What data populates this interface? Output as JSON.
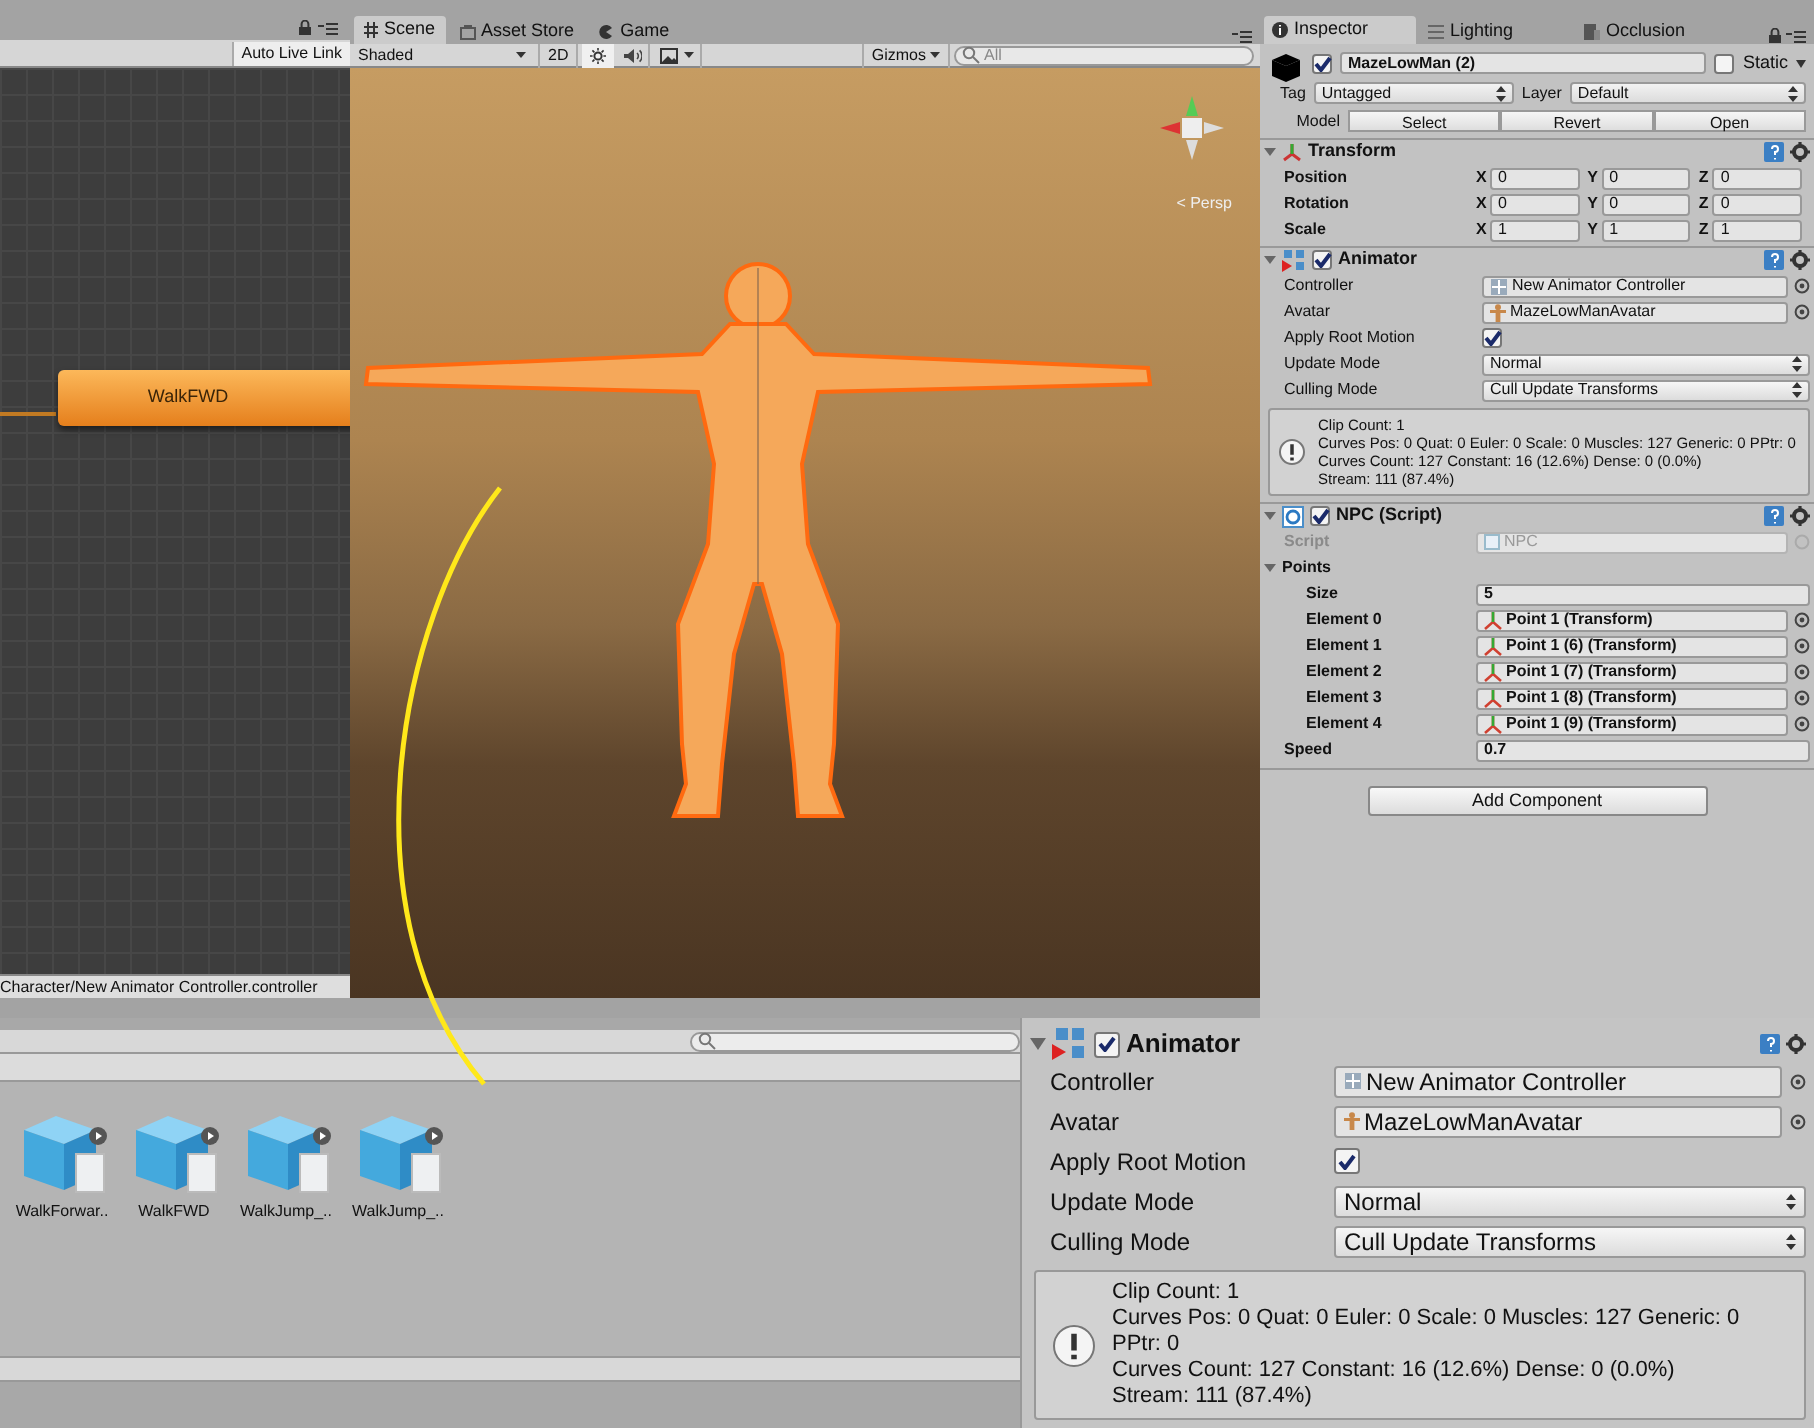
{
  "animator_window": {
    "auto_live_link": "Auto Live Link",
    "state": "WalkFWD",
    "path": "Character/New Animator Controller.controller"
  },
  "scene_window": {
    "tabs": [
      {
        "label": "Scene",
        "selected": true
      },
      {
        "label": "Asset Store",
        "selected": false
      },
      {
        "label": "Game",
        "selected": false
      }
    ],
    "shading": "Shaded",
    "mode_2d": "2D",
    "gizmos": "Gizmos",
    "search_placeholder": "All",
    "projection": "< Persp"
  },
  "inspector": {
    "tabs": [
      {
        "label": "Inspector",
        "selected": true
      },
      {
        "label": "Lighting",
        "selected": false
      },
      {
        "label": "Occlusion",
        "selected": false
      }
    ],
    "object": {
      "active": true,
      "name": "MazeLowMan (2)",
      "static": false,
      "static_label": "Static",
      "tag_label": "Tag",
      "tag": "Untagged",
      "layer_label": "Layer",
      "layer": "Default",
      "model_label": "Model",
      "model_buttons": [
        "Select",
        "Revert",
        "Open"
      ]
    },
    "components": [
      {
        "kind": "transform",
        "title": "Transform",
        "expanded": true,
        "rows": [
          {
            "label": "Position",
            "fields": [
              {
                "axis": "X",
                "value": "0"
              },
              {
                "axis": "Y",
                "value": "0"
              },
              {
                "axis": "Z",
                "value": "0"
              }
            ]
          },
          {
            "label": "Rotation",
            "fields": [
              {
                "axis": "X",
                "value": "0"
              },
              {
                "axis": "Y",
                "value": "0"
              },
              {
                "axis": "Z",
                "value": "0"
              }
            ]
          },
          {
            "label": "Scale",
            "fields": [
              {
                "axis": "X",
                "value": "1"
              },
              {
                "axis": "Y",
                "value": "1"
              },
              {
                "axis": "Z",
                "value": "1"
              }
            ]
          }
        ]
      },
      {
        "kind": "animator",
        "title": "Animator",
        "expanded": true,
        "enabled": true,
        "fields": [
          {
            "kind": "controller",
            "label": "Controller",
            "value": "New Animator Controller"
          },
          {
            "kind": "avatar",
            "label": "Avatar",
            "value": "MazeLowManAvatar"
          },
          {
            "kind": "checkbox",
            "label": "Apply Root Motion",
            "checked": true
          },
          {
            "kind": "dropdown",
            "label": "Update Mode",
            "value": "Normal"
          },
          {
            "kind": "dropdown",
            "label": "Culling Mode",
            "value": "Cull Update Transforms"
          }
        ],
        "info": [
          "Clip Count: 1",
          "Curves Pos: 0 Quat: 0 Euler: 0 Scale: 0 Muscles: 127 Generic: 0 PPtr: 0",
          "Curves Count: 127 Constant: 16 (12.6%) Dense: 0 (0.0%)",
          "Stream: 111 (87.4%)"
        ]
      },
      {
        "kind": "script",
        "title": "NPC (Script)",
        "expanded": true,
        "enabled": true,
        "script_label": "Script",
        "script": "NPC",
        "list": {
          "label": "Points",
          "expanded": true,
          "size_label": "Size",
          "size": "5",
          "elements": [
            {
              "label": "Element 0",
              "value": "Point 1 (Transform)"
            },
            {
              "label": "Element 1",
              "value": "Point 1 (6) (Transform)"
            },
            {
              "label": "Element 2",
              "value": "Point 1 (7) (Transform)"
            },
            {
              "label": "Element 3",
              "value": "Point 1 (8) (Transform)"
            },
            {
              "label": "Element 4",
              "value": "Point 1 (9) (Transform)"
            }
          ]
        },
        "speed_label": "Speed",
        "speed": "0.7"
      }
    ],
    "add_component": "Add Component"
  },
  "project_window": {
    "assets": [
      "WalkForwar..",
      "WalkFWD",
      "WalkJump_..",
      "WalkJump_.."
    ]
  },
  "zoomed_animator": {
    "title": "Animator",
    "expanded": true,
    "enabled": true,
    "fields": [
      {
        "kind": "controller",
        "label": "Controller",
        "value": "New Animator Controller"
      },
      {
        "kind": "avatar",
        "label": "Avatar",
        "value": "MazeLowManAvatar"
      },
      {
        "kind": "checkbox",
        "label": "Apply Root Motion",
        "checked": true
      },
      {
        "kind": "dropdown",
        "label": "Update Mode",
        "value": "Normal"
      },
      {
        "kind": "dropdown",
        "label": "Culling Mode",
        "value": "Cull Update Transforms"
      }
    ],
    "info": [
      "Clip Count: 1",
      "Curves Pos: 0 Quat: 0 Euler: 0 Scale: 0 Muscles: 127 Generic: 0 PPtr: 0",
      "Curves Count: 127 Constant: 16 (12.6%) Dense: 0 (0.0%)",
      "Stream: 111 (87.4%)"
    ]
  }
}
